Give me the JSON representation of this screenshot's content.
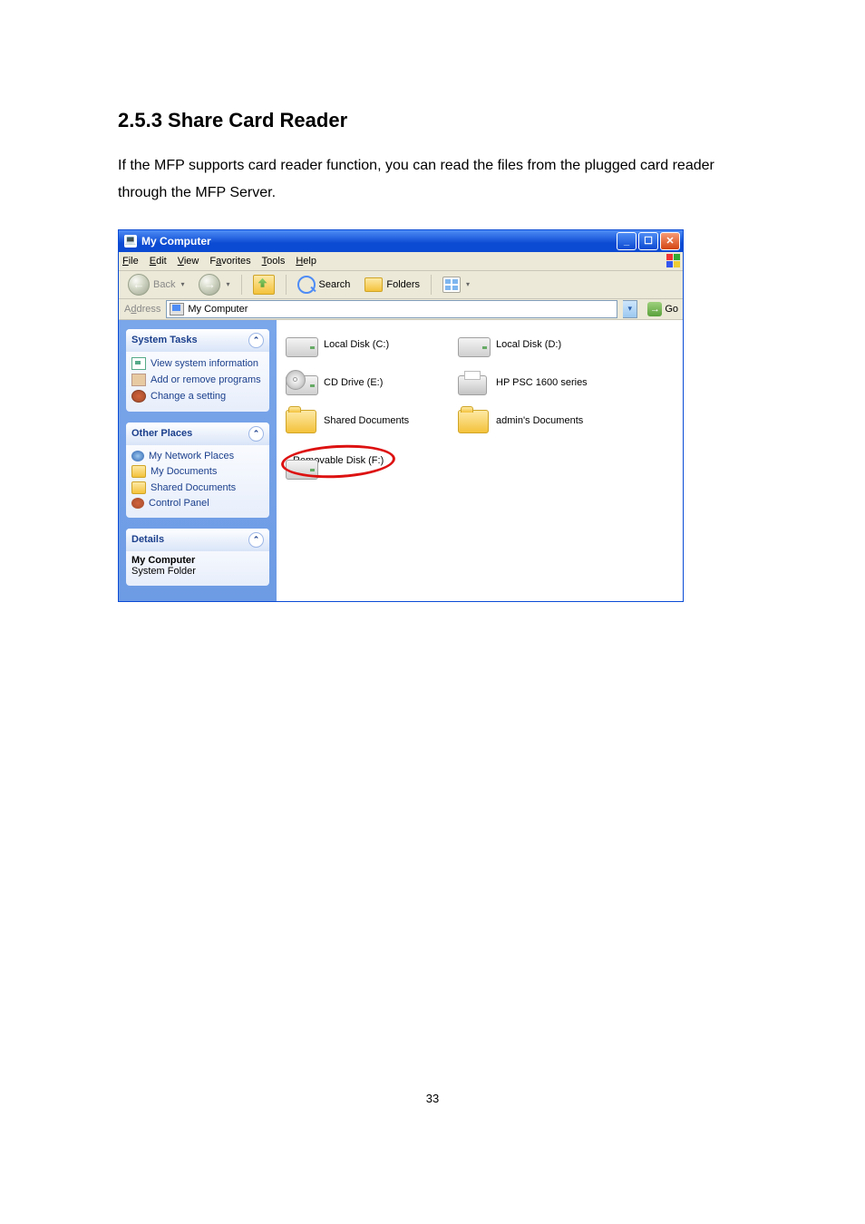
{
  "heading": "2.5.3 Share Card Reader",
  "paragraph": "If the MFP supports card reader function, you can read the files from the plugged card reader through the MFP Server.",
  "page_number": "33",
  "window": {
    "title": "My Computer",
    "menu": {
      "file": "File",
      "edit": "Edit",
      "view": "View",
      "favorites": "Favorites",
      "tools": "Tools",
      "help": "Help"
    },
    "toolbar": {
      "back": "Back",
      "search": "Search",
      "folders": "Folders"
    },
    "address": {
      "label": "Address",
      "value": "My Computer",
      "go": "Go"
    },
    "sidebar": {
      "system_tasks": {
        "title": "System Tasks",
        "items": [
          "View system information",
          "Add or remove programs",
          "Change a setting"
        ]
      },
      "other_places": {
        "title": "Other Places",
        "items": [
          "My Network Places",
          "My Documents",
          "Shared Documents",
          "Control Panel"
        ]
      },
      "details": {
        "title": "Details",
        "name": "My Computer",
        "type": "System Folder"
      }
    },
    "drives": {
      "c": "Local Disk (C:)",
      "d": "Local Disk (D:)",
      "e": "CD Drive (E:)",
      "printer": "HP PSC 1600 series",
      "shared": "Shared Documents",
      "admin": "admin's Documents",
      "f": "Removable Disk (F:)"
    }
  }
}
